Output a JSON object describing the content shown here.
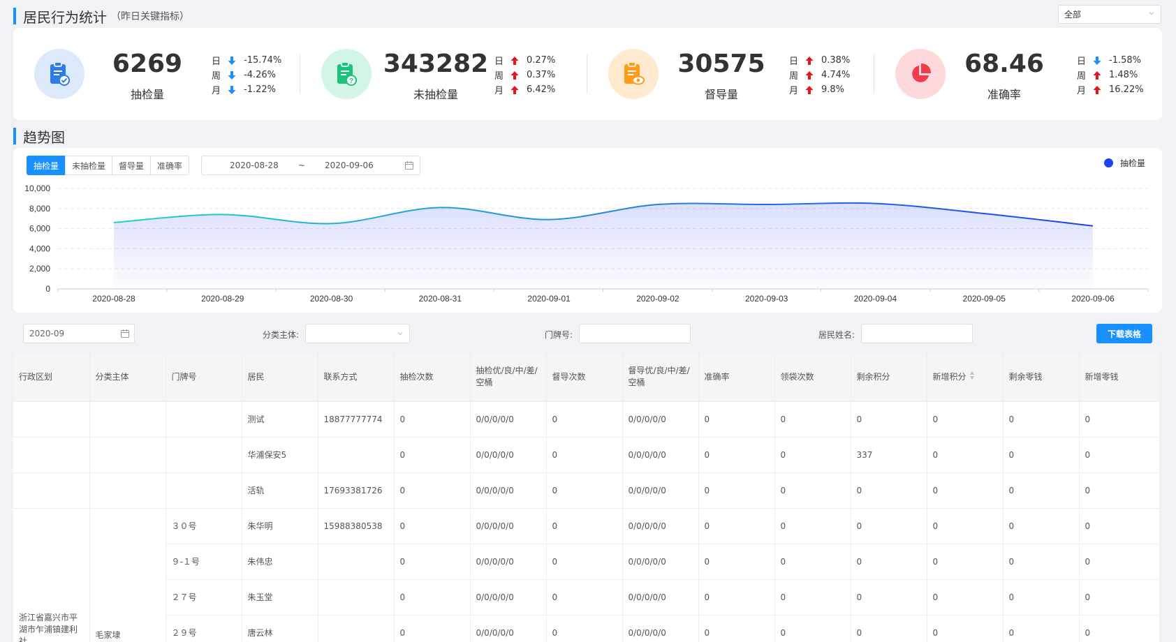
{
  "header": {
    "title": "居民行为统计",
    "subtitle": "（昨日关键指标）",
    "scope_select": "全部"
  },
  "kpis": [
    {
      "value": "6269",
      "label": "抽检量",
      "icon": "clipboard-check-icon",
      "color": "#2f7be8",
      "changes": [
        {
          "period": "日",
          "dir": "down",
          "value": "-15.74%"
        },
        {
          "period": "周",
          "dir": "down",
          "value": "-4.26%"
        },
        {
          "period": "月",
          "dir": "down",
          "value": "-1.22%"
        }
      ]
    },
    {
      "value": "343282",
      "label": "未抽检量",
      "icon": "clipboard-question-icon",
      "color": "#19c37d",
      "changes": [
        {
          "period": "日",
          "dir": "up",
          "value": "0.27%"
        },
        {
          "period": "周",
          "dir": "up",
          "value": "0.37%"
        },
        {
          "period": "月",
          "dir": "up",
          "value": "6.42%"
        }
      ]
    },
    {
      "value": "30575",
      "label": "督导量",
      "icon": "clipboard-eye-icon",
      "color": "#ff9a1a",
      "changes": [
        {
          "period": "日",
          "dir": "up",
          "value": "0.38%"
        },
        {
          "period": "周",
          "dir": "up",
          "value": "4.74%"
        },
        {
          "period": "月",
          "dir": "up",
          "value": "9.8%"
        }
      ]
    },
    {
      "value": "68.46",
      "label": "准确率",
      "icon": "pie-chart-icon",
      "color": "#f23b4b",
      "changes": [
        {
          "period": "日",
          "dir": "down",
          "value": "-1.58%"
        },
        {
          "period": "周",
          "dir": "up",
          "value": "1.48%"
        },
        {
          "period": "月",
          "dir": "up",
          "value": "16.22%"
        }
      ]
    }
  ],
  "trend": {
    "title": "趋势图",
    "tabs": [
      "抽检量",
      "未抽检量",
      "督导量",
      "准确率"
    ],
    "active_tab": 0,
    "date_start": "2020-08-28",
    "date_sep": "~",
    "date_end": "2020-09-06",
    "legend": "抽检量"
  },
  "chart_data": {
    "type": "area",
    "x": [
      "2020-08-28",
      "2020-08-29",
      "2020-08-30",
      "2020-08-31",
      "2020-09-01",
      "2020-09-02",
      "2020-09-03",
      "2020-09-04",
      "2020-09-05",
      "2020-09-06"
    ],
    "series": [
      {
        "name": "抽检量",
        "values": [
          6600,
          7400,
          6500,
          8100,
          6900,
          8400,
          8400,
          8500,
          7500,
          6269
        ]
      }
    ],
    "ylim": [
      0,
      10000
    ],
    "yticks": [
      "0",
      "2,000",
      "4,000",
      "6,000",
      "8,000",
      "10,000"
    ],
    "grid": true,
    "legend_position": "top-right",
    "colors": {
      "start": "#22d3c5",
      "end": "#1d43f0"
    }
  },
  "filters": {
    "month": "2020-09",
    "category_label": "分类主体:",
    "category_value": "",
    "door_label": "门牌号:",
    "door_value": "",
    "name_label": "居民姓名:",
    "name_value": "",
    "download": "下载表格"
  },
  "table": {
    "columns": [
      "行政区划",
      "分类主体",
      "门牌号",
      "居民",
      "联系方式",
      "抽检次数",
      "抽检优/良/中/差/空桶",
      "督导次数",
      "督导优/良/中/差/空桶",
      "准确率",
      "领袋次数",
      "剩余积分",
      "新增积分",
      "剩余零钱",
      "新增零钱"
    ],
    "rows": [
      [
        "",
        "",
        "",
        "测试",
        "18877777774",
        "0",
        "0/0/0/0/0",
        "0",
        "0/0/0/0/0",
        "0",
        "0",
        "0",
        "0",
        "0",
        "0"
      ],
      [
        "",
        "",
        "",
        "华浦保安5",
        "",
        "0",
        "0/0/0/0/0",
        "0",
        "0/0/0/0/0",
        "0",
        "0",
        "337",
        "0",
        "0",
        "0"
      ],
      [
        "",
        "",
        "",
        "活轨",
        "17693381726",
        "0",
        "0/0/0/0/0",
        "0",
        "0/0/0/0/0",
        "0",
        "0",
        "0",
        "0",
        "0",
        "0"
      ],
      [
        "浙江省嘉兴市平湖市乍浦镇建利社",
        "毛家埭",
        "３０号",
        "朱华明",
        "15988380538",
        "0",
        "0/0/0/0/0",
        "0",
        "0/0/0/0/0",
        "0",
        "0",
        "0",
        "0",
        "0",
        "0"
      ],
      [
        "",
        "",
        "９-１号",
        "朱伟忠",
        "",
        "0",
        "0/0/0/0/0",
        "0",
        "0/0/0/0/0",
        "0",
        "0",
        "0",
        "0",
        "0",
        "0"
      ],
      [
        "",
        "",
        "２７号",
        "朱玉堂",
        "",
        "0",
        "0/0/0/0/0",
        "0",
        "0/0/0/0/0",
        "0",
        "0",
        "0",
        "0",
        "0",
        "0"
      ],
      [
        "",
        "",
        "２９号",
        "唐云林",
        "",
        "0",
        "0/0/0/0/0",
        "0",
        "0/0/0/0/0",
        "0",
        "0",
        "0",
        "0",
        "0",
        "0"
      ]
    ]
  }
}
